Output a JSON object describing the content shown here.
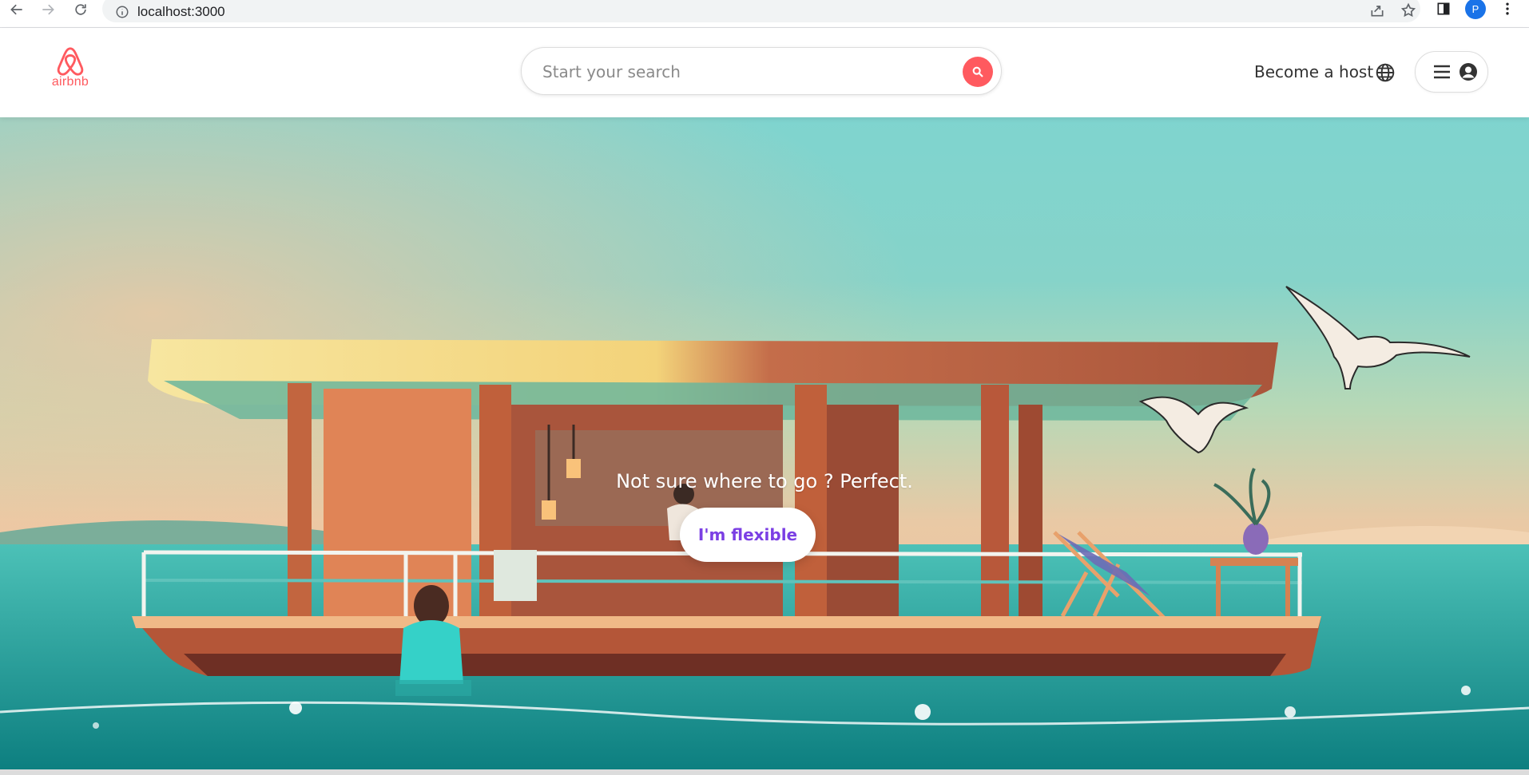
{
  "browser": {
    "url": "localhost:3000",
    "profile_initial": "P"
  },
  "header": {
    "logo_text": "airbnb",
    "search_placeholder": "Start your search",
    "become_host_label": "Become a host"
  },
  "hero": {
    "tagline": "Not sure where to go ? Perfect.",
    "button_label": "I'm flexible"
  },
  "colors": {
    "brand": "#ff5a5f",
    "button_text": "#7b3fe4"
  },
  "icons": {
    "back": "arrow-left-icon",
    "forward": "arrow-right-icon",
    "reload": "reload-icon",
    "site_info": "info-icon",
    "share": "share-icon",
    "bookmark": "star-icon",
    "side_panel": "side-panel-icon",
    "more": "kebab-menu-icon",
    "search": "search-icon",
    "globe": "globe-icon",
    "menu": "hamburger-menu-icon",
    "account": "account-circle-icon"
  }
}
